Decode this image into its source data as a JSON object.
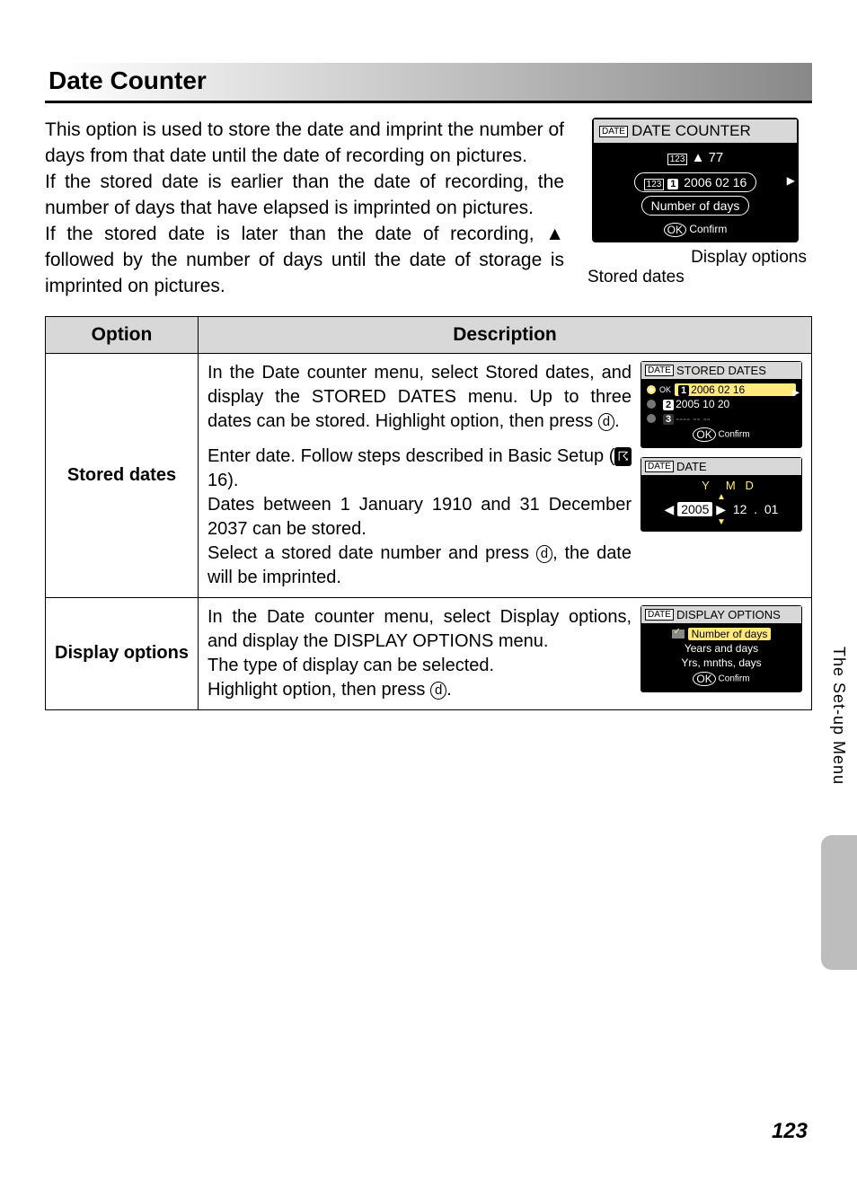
{
  "heading": "Date Counter",
  "intro": {
    "p1": "This option is used to store the date and imprint the number of days from that date until the date of recording on pictures.",
    "p2": "If the stored date is earlier than the date of recording, the number of days that have elapsed is imprinted on pictures.",
    "p3": "If the stored date is later than the date of recording, ▲ followed by the number of days until the date of storage is imprinted on pictures."
  },
  "main_lcd": {
    "title": "DATE COUNTER",
    "count_line": "▲  77",
    "stored_date": "2006 02 16",
    "option_label": "Number of days",
    "confirm": "Confirm"
  },
  "callouts": {
    "right": "Display options",
    "left": "Stored dates"
  },
  "table": {
    "head_option": "Option",
    "head_desc": "Description",
    "row1": {
      "label": "Stored dates",
      "p1": "In the Date counter menu, select Stored dates, and display the STORED DATES menu. Up to three dates can be stored. Highlight option, then press ",
      "p1_suffix": ".",
      "p2a": "Enter date. Follow steps described in Basic Setup (",
      "p2b": "16).",
      "p3": "Dates between 1 January 1910 and 31 December 2037 can be stored.",
      "p4a": "Select a stored date number and press ",
      "p4b": ", the date will be imprinted.",
      "screen1": {
        "title": "STORED DATES",
        "r1": "2006 02 16",
        "r2": "2005 10 20",
        "r3": "---- -- --",
        "confirm": "Confirm"
      },
      "screen2": {
        "title": "DATE",
        "ymd": "Y   M   D",
        "year": "2005",
        "month": "12",
        "day": "01"
      }
    },
    "row2": {
      "label": "Display options",
      "p1": "In the Date counter menu, select Display options, and display the DISPLAY OPTIONS menu.",
      "p2": "The type of display can be selected.",
      "p3a": "Highlight option, then press ",
      "p3b": ".",
      "screen": {
        "title": "DISPLAY OPTIONS",
        "o1": "Number of days",
        "o2": "Years and days",
        "o3": "Yrs, mnths, days",
        "confirm": "Confirm"
      }
    }
  },
  "side_tab": "The Set-up Menu",
  "page_number": "123",
  "glyphs": {
    "ok": "d",
    "date_badge": "DATE",
    "num_badge": "123"
  }
}
